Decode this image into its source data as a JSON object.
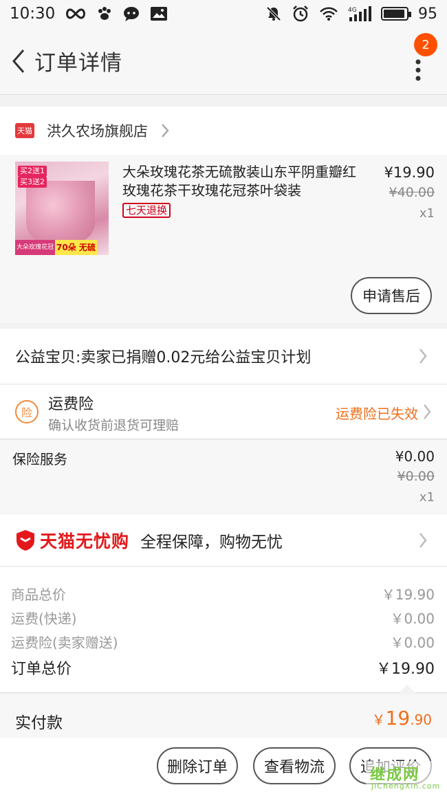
{
  "status_bar": {
    "time": "10:30",
    "network": "4G",
    "battery": "95",
    "battery_level": 0.95
  },
  "nav": {
    "title": "订单详情",
    "badge_count": "2",
    "icons": [
      "back-arrow-icon",
      "more-vertical-icon"
    ]
  },
  "shop": {
    "icon_text": "天猫",
    "name": "洪久农场旗舰店"
  },
  "product": {
    "title": "大朵玫瑰花茶无硫散装山东平阴重瓣红玫瑰花茶干玫瑰花冠茶叶袋装",
    "tag": "七天退换",
    "price": "¥19.90",
    "original_price": "¥40.00",
    "quantity": "x1",
    "after_sale_label": "申请售后",
    "thumb": {
      "tag1": "买2送1",
      "tag2": "买3送2",
      "caption1": "大朵玫瑰花冠",
      "caption2": "70朵 无硫"
    }
  },
  "charity": {
    "text": "公益宝贝:卖家已捐赠0.02元给公益宝贝计划"
  },
  "shipping_insurance": {
    "icon_text": "险",
    "title": "运费险",
    "subtitle": "确认收货前退货可理赔",
    "status": "运费险已失效"
  },
  "insurance_service": {
    "label": "保险服务",
    "price": "¥0.00",
    "original_price": "¥0.00",
    "quantity": "x1"
  },
  "worry_free": {
    "brand": "天猫无忧购",
    "text": "全程保障，购物无忧"
  },
  "summary": {
    "rows": [
      {
        "label": "商品总价",
        "value": "￥19.90"
      },
      {
        "label": "运费(快递)",
        "value": "￥0.00"
      },
      {
        "label": "运费险(卖家赠送)",
        "value": "￥0.00"
      }
    ],
    "total_label": "订单总价",
    "total_value": "￥19.90"
  },
  "paid": {
    "label": "实付款",
    "currency": "￥",
    "amount_int": "19",
    "amount_dec": ".90"
  },
  "actions": {
    "delete": "删除订单",
    "logistics": "查看物流",
    "review": "追加评价"
  },
  "watermark": {
    "top": "继成网",
    "bottom": "JiChengXin.com"
  },
  "colors": {
    "accent_orange": "#f06e1a",
    "tmall_red": "#e4181b",
    "badge": "#ff5000"
  }
}
